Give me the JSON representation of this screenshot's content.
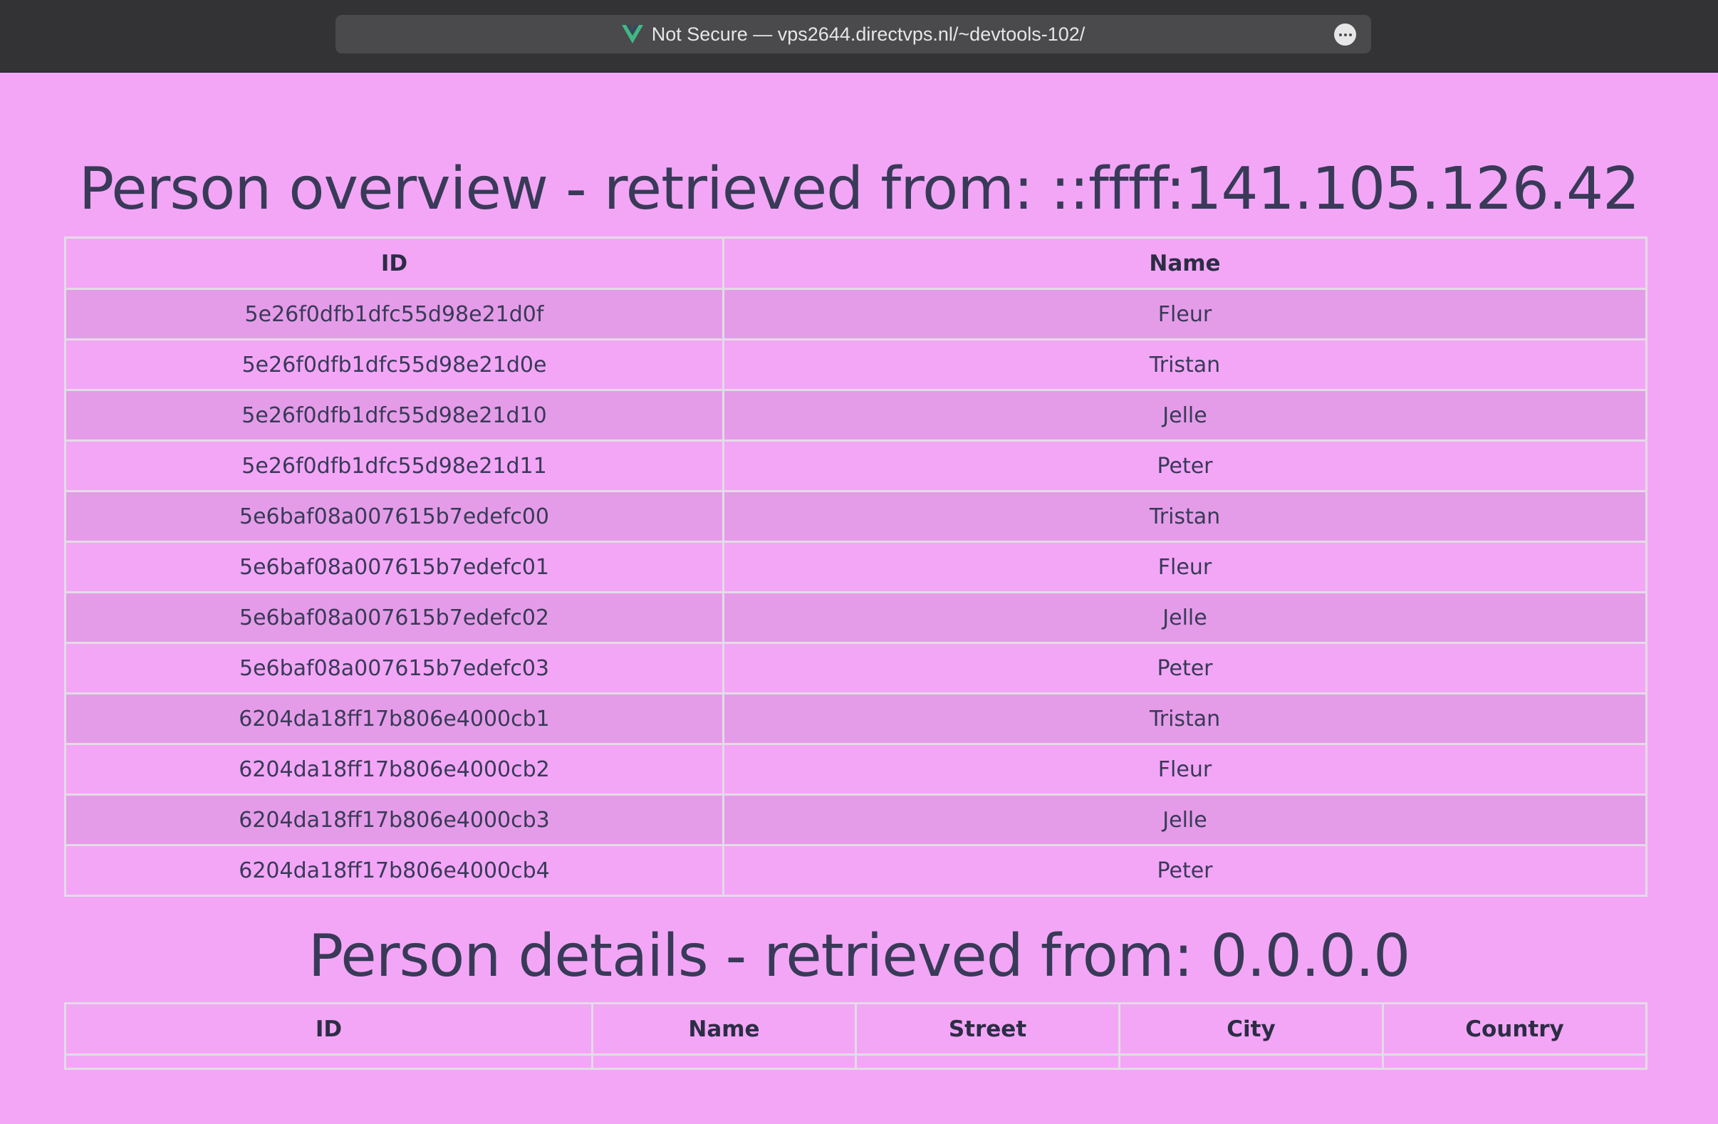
{
  "browser": {
    "url_text": "Not Secure — vps2644.directvps.nl/~devtools-102/",
    "site_icon": "vue-logo-icon",
    "more_icon": "more-options-icon"
  },
  "overview": {
    "title": "Person overview - retrieved from: ::ffff:141.105.126.42",
    "columns": [
      "ID",
      "Name"
    ],
    "rows": [
      {
        "id": "5e26f0dfb1dfc55d98e21d0f",
        "name": "Fleur"
      },
      {
        "id": "5e26f0dfb1dfc55d98e21d0e",
        "name": "Tristan"
      },
      {
        "id": "5e26f0dfb1dfc55d98e21d10",
        "name": "Jelle"
      },
      {
        "id": "5e26f0dfb1dfc55d98e21d11",
        "name": "Peter"
      },
      {
        "id": "5e6baf08a007615b7edefc00",
        "name": "Tristan"
      },
      {
        "id": "5e6baf08a007615b7edefc01",
        "name": "Fleur"
      },
      {
        "id": "5e6baf08a007615b7edefc02",
        "name": "Jelle"
      },
      {
        "id": "5e6baf08a007615b7edefc03",
        "name": "Peter"
      },
      {
        "id": "6204da18ff17b806e4000cb1",
        "name": "Tristan"
      },
      {
        "id": "6204da18ff17b806e4000cb2",
        "name": "Fleur"
      },
      {
        "id": "6204da18ff17b806e4000cb3",
        "name": "Jelle"
      },
      {
        "id": "6204da18ff17b806e4000cb4",
        "name": "Peter"
      }
    ]
  },
  "details": {
    "title": "Person details - retrieved from: 0.0.0.0",
    "columns": [
      "ID",
      "Name",
      "Street",
      "City",
      "Country"
    ]
  },
  "colors": {
    "page_background": "#f3a6f6",
    "row_stripe": "#e59ce8",
    "text": "#383a58",
    "table_border": "#e4dbe7",
    "toolbar": "#333235"
  }
}
